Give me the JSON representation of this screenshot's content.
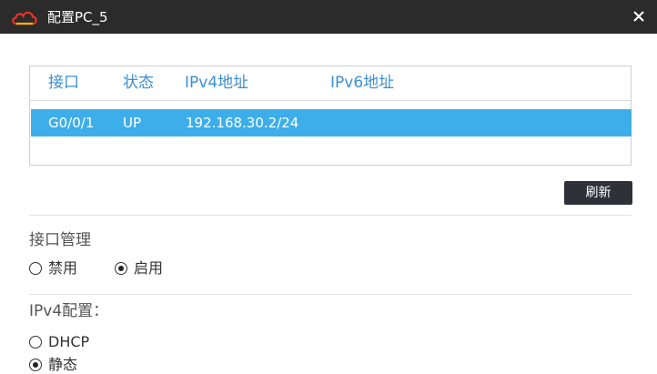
{
  "window": {
    "title": "配置PC_5"
  },
  "interfaces": {
    "columns": [
      "接口",
      "状态",
      "IPv4地址",
      "IPv6地址"
    ],
    "rows": [
      {
        "interface": "G0/0/1",
        "status": "UP",
        "ipv4": "192.168.30.2/24",
        "ipv6": ""
      }
    ],
    "refresh_label": "刷新"
  },
  "iface_mgmt": {
    "label": "接口管理",
    "options": [
      {
        "label": "禁用",
        "checked": false
      },
      {
        "label": "启用",
        "checked": true
      }
    ]
  },
  "ipv4_config": {
    "label": "IPv4配置：",
    "options": [
      {
        "label": "DHCP",
        "checked": false
      },
      {
        "label": "静态",
        "checked": true
      }
    ]
  },
  "colors": {
    "titlebar": "#2b2b2b",
    "header_text": "#3a8fd3",
    "selected_row": "#3daee9",
    "button": "#2e3138"
  }
}
